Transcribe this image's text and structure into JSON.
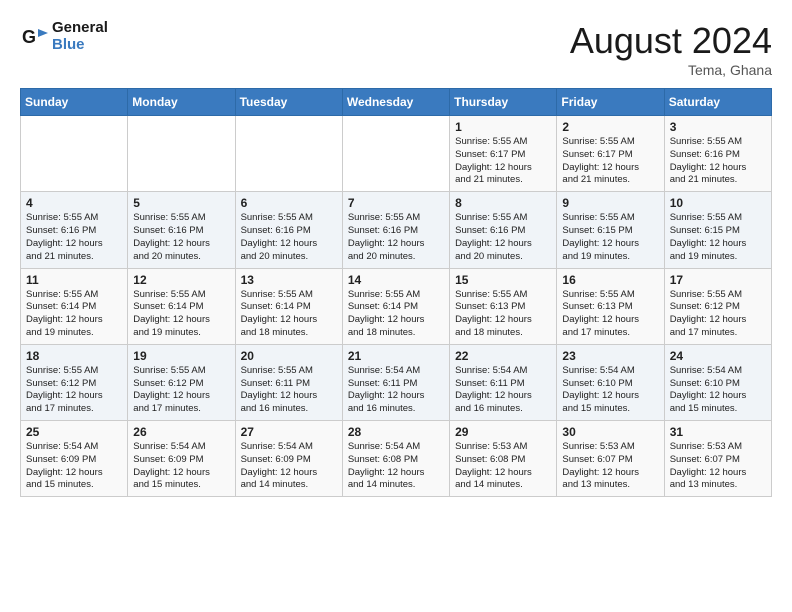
{
  "header": {
    "logo_line1": "General",
    "logo_line2": "Blue",
    "month_year": "August 2024",
    "location": "Tema, Ghana"
  },
  "weekdays": [
    "Sunday",
    "Monday",
    "Tuesday",
    "Wednesday",
    "Thursday",
    "Friday",
    "Saturday"
  ],
  "weeks": [
    [
      {
        "day": "",
        "info": ""
      },
      {
        "day": "",
        "info": ""
      },
      {
        "day": "",
        "info": ""
      },
      {
        "day": "",
        "info": ""
      },
      {
        "day": "1",
        "info": "Sunrise: 5:55 AM\nSunset: 6:17 PM\nDaylight: 12 hours\nand 21 minutes."
      },
      {
        "day": "2",
        "info": "Sunrise: 5:55 AM\nSunset: 6:17 PM\nDaylight: 12 hours\nand 21 minutes."
      },
      {
        "day": "3",
        "info": "Sunrise: 5:55 AM\nSunset: 6:16 PM\nDaylight: 12 hours\nand 21 minutes."
      }
    ],
    [
      {
        "day": "4",
        "info": "Sunrise: 5:55 AM\nSunset: 6:16 PM\nDaylight: 12 hours\nand 21 minutes."
      },
      {
        "day": "5",
        "info": "Sunrise: 5:55 AM\nSunset: 6:16 PM\nDaylight: 12 hours\nand 20 minutes."
      },
      {
        "day": "6",
        "info": "Sunrise: 5:55 AM\nSunset: 6:16 PM\nDaylight: 12 hours\nand 20 minutes."
      },
      {
        "day": "7",
        "info": "Sunrise: 5:55 AM\nSunset: 6:16 PM\nDaylight: 12 hours\nand 20 minutes."
      },
      {
        "day": "8",
        "info": "Sunrise: 5:55 AM\nSunset: 6:16 PM\nDaylight: 12 hours\nand 20 minutes."
      },
      {
        "day": "9",
        "info": "Sunrise: 5:55 AM\nSunset: 6:15 PM\nDaylight: 12 hours\nand 19 minutes."
      },
      {
        "day": "10",
        "info": "Sunrise: 5:55 AM\nSunset: 6:15 PM\nDaylight: 12 hours\nand 19 minutes."
      }
    ],
    [
      {
        "day": "11",
        "info": "Sunrise: 5:55 AM\nSunset: 6:14 PM\nDaylight: 12 hours\nand 19 minutes."
      },
      {
        "day": "12",
        "info": "Sunrise: 5:55 AM\nSunset: 6:14 PM\nDaylight: 12 hours\nand 19 minutes."
      },
      {
        "day": "13",
        "info": "Sunrise: 5:55 AM\nSunset: 6:14 PM\nDaylight: 12 hours\nand 18 minutes."
      },
      {
        "day": "14",
        "info": "Sunrise: 5:55 AM\nSunset: 6:14 PM\nDaylight: 12 hours\nand 18 minutes."
      },
      {
        "day": "15",
        "info": "Sunrise: 5:55 AM\nSunset: 6:13 PM\nDaylight: 12 hours\nand 18 minutes."
      },
      {
        "day": "16",
        "info": "Sunrise: 5:55 AM\nSunset: 6:13 PM\nDaylight: 12 hours\nand 17 minutes."
      },
      {
        "day": "17",
        "info": "Sunrise: 5:55 AM\nSunset: 6:12 PM\nDaylight: 12 hours\nand 17 minutes."
      }
    ],
    [
      {
        "day": "18",
        "info": "Sunrise: 5:55 AM\nSunset: 6:12 PM\nDaylight: 12 hours\nand 17 minutes."
      },
      {
        "day": "19",
        "info": "Sunrise: 5:55 AM\nSunset: 6:12 PM\nDaylight: 12 hours\nand 17 minutes."
      },
      {
        "day": "20",
        "info": "Sunrise: 5:55 AM\nSunset: 6:11 PM\nDaylight: 12 hours\nand 16 minutes."
      },
      {
        "day": "21",
        "info": "Sunrise: 5:54 AM\nSunset: 6:11 PM\nDaylight: 12 hours\nand 16 minutes."
      },
      {
        "day": "22",
        "info": "Sunrise: 5:54 AM\nSunset: 6:11 PM\nDaylight: 12 hours\nand 16 minutes."
      },
      {
        "day": "23",
        "info": "Sunrise: 5:54 AM\nSunset: 6:10 PM\nDaylight: 12 hours\nand 15 minutes."
      },
      {
        "day": "24",
        "info": "Sunrise: 5:54 AM\nSunset: 6:10 PM\nDaylight: 12 hours\nand 15 minutes."
      }
    ],
    [
      {
        "day": "25",
        "info": "Sunrise: 5:54 AM\nSunset: 6:09 PM\nDaylight: 12 hours\nand 15 minutes."
      },
      {
        "day": "26",
        "info": "Sunrise: 5:54 AM\nSunset: 6:09 PM\nDaylight: 12 hours\nand 15 minutes."
      },
      {
        "day": "27",
        "info": "Sunrise: 5:54 AM\nSunset: 6:09 PM\nDaylight: 12 hours\nand 14 minutes."
      },
      {
        "day": "28",
        "info": "Sunrise: 5:54 AM\nSunset: 6:08 PM\nDaylight: 12 hours\nand 14 minutes."
      },
      {
        "day": "29",
        "info": "Sunrise: 5:53 AM\nSunset: 6:08 PM\nDaylight: 12 hours\nand 14 minutes."
      },
      {
        "day": "30",
        "info": "Sunrise: 5:53 AM\nSunset: 6:07 PM\nDaylight: 12 hours\nand 13 minutes."
      },
      {
        "day": "31",
        "info": "Sunrise: 5:53 AM\nSunset: 6:07 PM\nDaylight: 12 hours\nand 13 minutes."
      }
    ]
  ]
}
